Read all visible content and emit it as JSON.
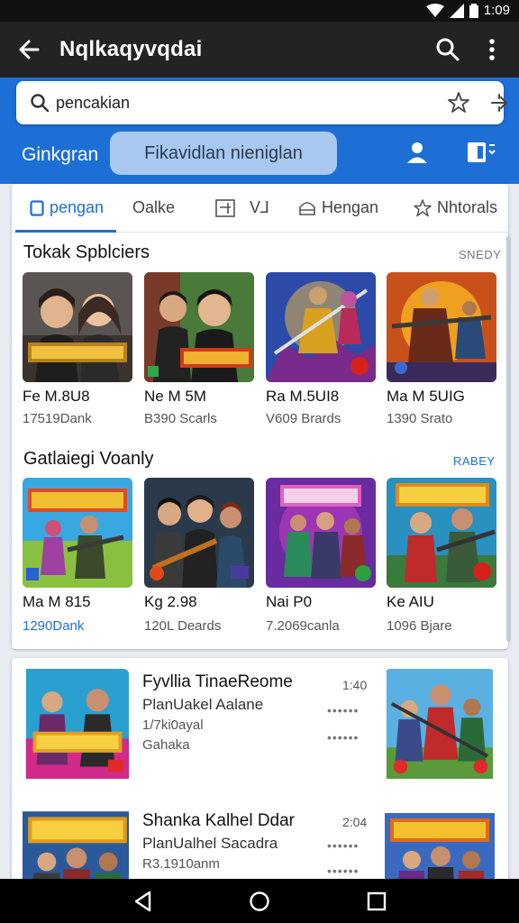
{
  "status": {
    "time": "1:09"
  },
  "app_bar": {
    "title": "Nqlkaqyvqdai"
  },
  "search": {
    "value": "pencakian"
  },
  "band": {
    "label": "Ginkgran",
    "chip": "Fikavidlan nieniglan"
  },
  "tabs": [
    {
      "label": "pengan",
      "icon": "square-icon"
    },
    {
      "label": "Oalke",
      "icon": ""
    },
    {
      "label": "V⅃",
      "icon": "window-icon"
    },
    {
      "label": "Hengan",
      "icon": "bag-icon"
    },
    {
      "label": "Nhtorals",
      "icon": "star-icon"
    }
  ],
  "section1": {
    "title": "Tokak Spblciers",
    "link": "SNEDY",
    "items": [
      {
        "name": "Fe M.8U8",
        "sub": "17519Dank"
      },
      {
        "name": "Ne M 5M",
        "sub": "B390 Scarls"
      },
      {
        "name": "Ra M.5UI8",
        "sub": "V609 Brards"
      },
      {
        "name": "Ma M 5UIG",
        "sub": "1390 Srato"
      }
    ]
  },
  "section2": {
    "title": "Gatlaiegi Voanly",
    "link": "RABEY",
    "items": [
      {
        "name": "Ma M 815",
        "sub": "1290Dank"
      },
      {
        "name": "Kg 2.98",
        "sub": "120L Deards"
      },
      {
        "name": "Nai P0",
        "sub": "7.2069canla"
      },
      {
        "name": "Ke AIU",
        "sub": "1096 Bjare"
      }
    ]
  },
  "list": [
    {
      "title": "Fyvllia TinaeReome",
      "line2": "PlanUakel Aalane",
      "line3": "1/7ki0ayal",
      "line4": "Gahaka",
      "time": "1:40"
    },
    {
      "title": "Shanka Kalhel Ddar",
      "line2": "PlanUalhel Sacadra",
      "line3": "R3.1910anm",
      "time": "2:04"
    }
  ],
  "colors": {
    "accent": "#1d6fd6",
    "app_bar": "#232323",
    "chip": "#a9c8f0"
  }
}
